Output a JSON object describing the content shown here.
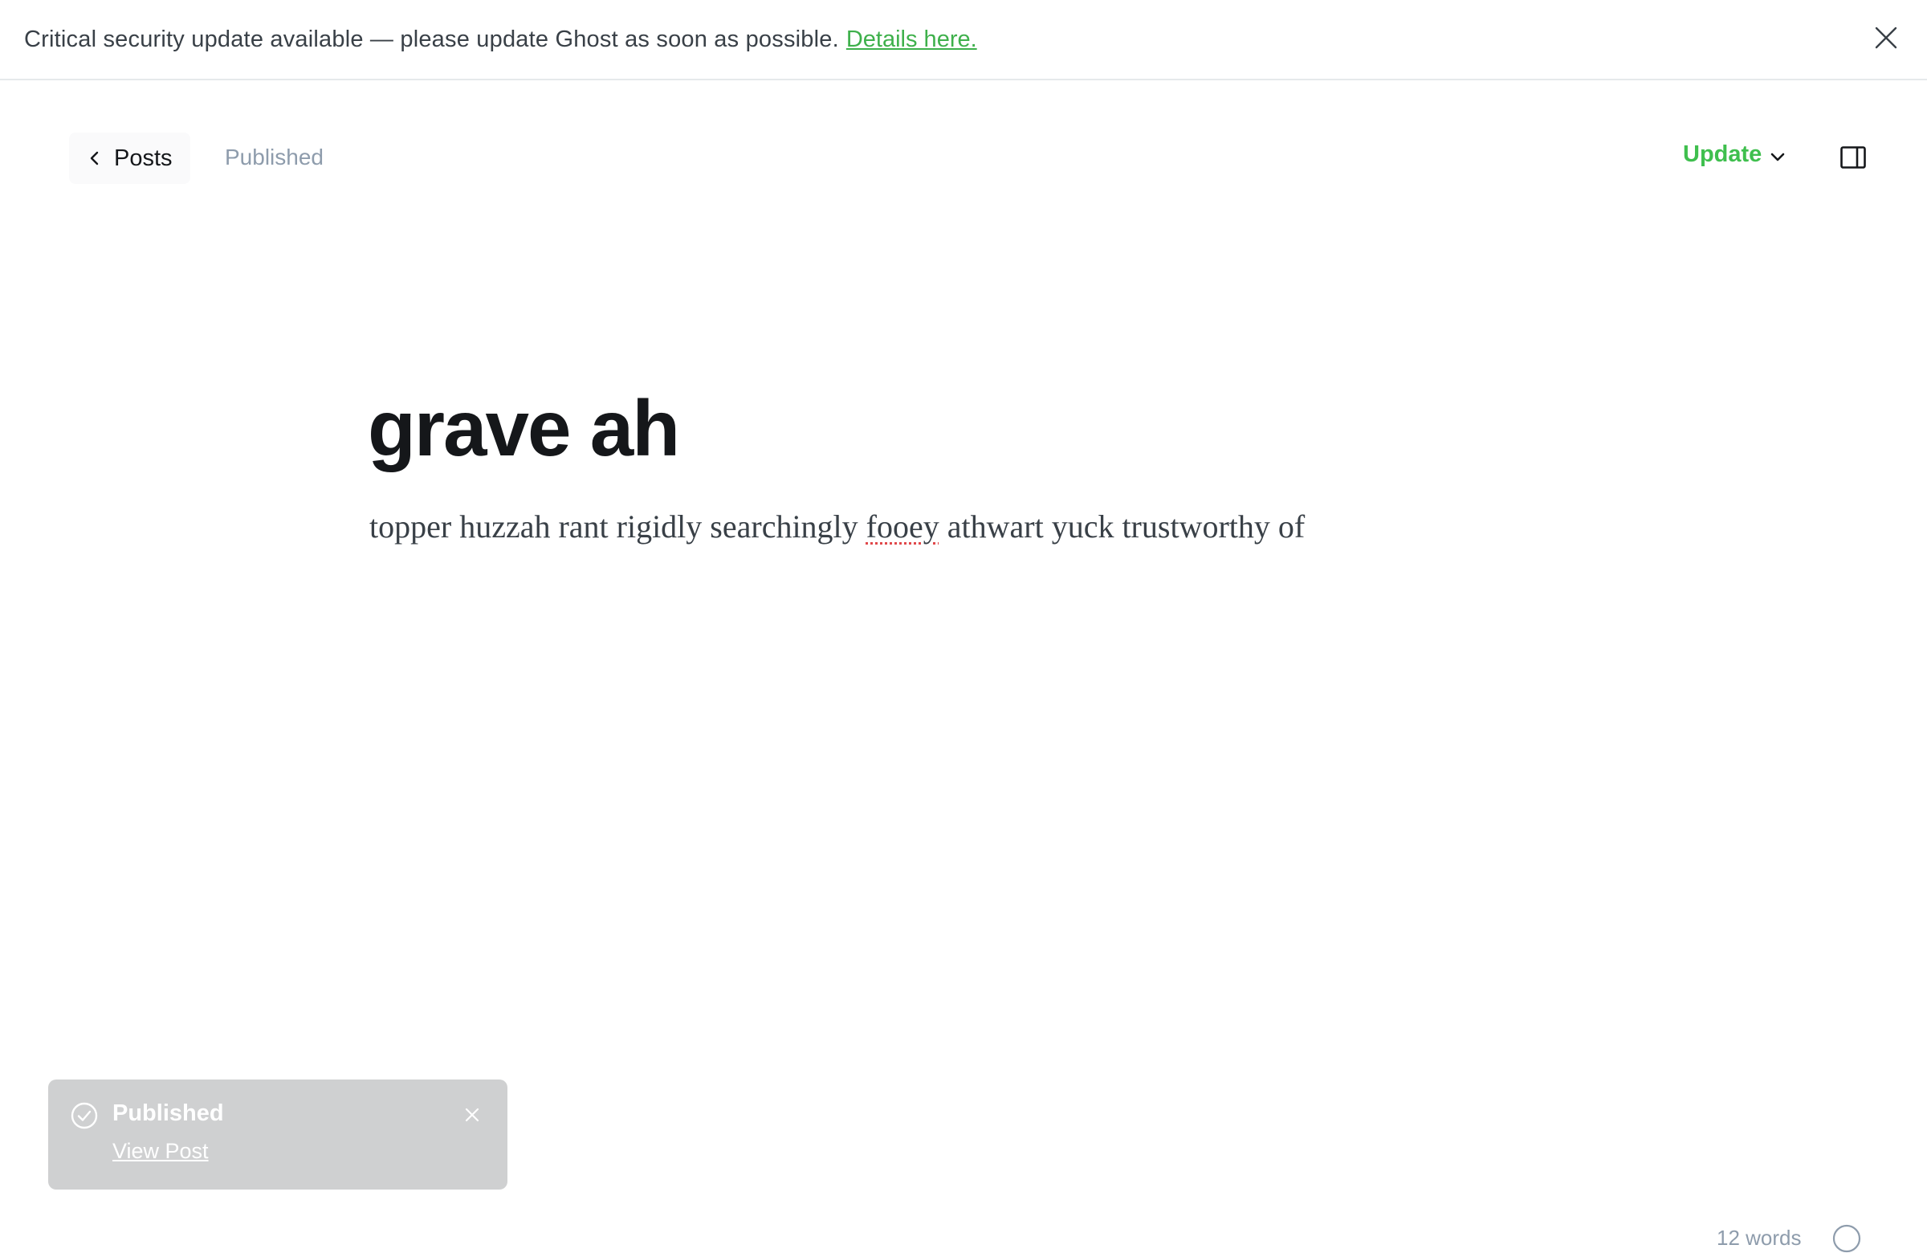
{
  "alert": {
    "message": "Critical security update available — please update Ghost as soon as possible.",
    "link_label": "Details here.",
    "close_icon": "close-icon"
  },
  "header": {
    "back_label": "Posts",
    "back_icon": "chevron-left-icon",
    "status": "Published",
    "update_label": "Update",
    "update_icon": "chevron-down-icon",
    "sidebar_icon": "sidebar-toggle-icon"
  },
  "post": {
    "title": "grave ah",
    "body_before": "topper huzzah rant rigidly searchingly ",
    "body_misspelled": "fooey",
    "body_after": " athwart yuck trustworthy of"
  },
  "toast": {
    "title": "Published",
    "link_label": "View Post",
    "check_icon": "check-circle-icon",
    "close_icon": "close-icon"
  },
  "footer": {
    "word_count": "12 words",
    "help_icon": "help-icon"
  },
  "colors": {
    "accent_green": "#3fbf4e",
    "text_primary": "#15171a",
    "text_muted": "#8e9cac",
    "toast_bg": "#cfd0d1"
  }
}
